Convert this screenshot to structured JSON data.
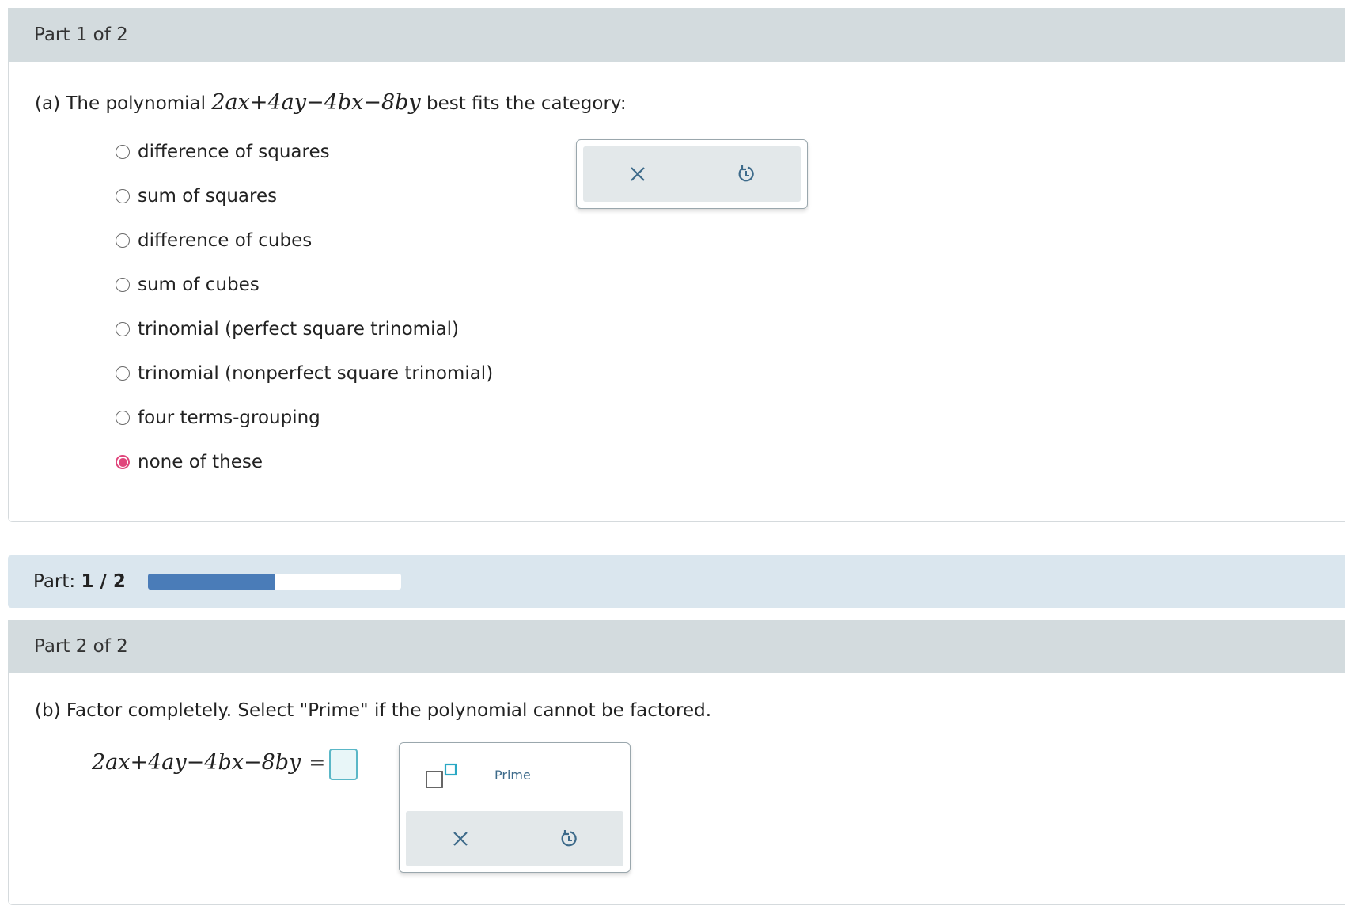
{
  "part1": {
    "header": "Part 1 of 2",
    "question_prefix": "(a) The polynomial ",
    "polynomial": "2ax+4ay−4bx−8by",
    "question_suffix": " best fits the category:",
    "options": [
      {
        "label": "difference of squares",
        "selected": false
      },
      {
        "label": "sum of squares",
        "selected": false
      },
      {
        "label": "difference of cubes",
        "selected": false
      },
      {
        "label": "sum of cubes",
        "selected": false
      },
      {
        "label": "trinomial (perfect square trinomial)",
        "selected": false
      },
      {
        "label": "trinomial (nonperfect square trinomial)",
        "selected": false
      },
      {
        "label": "four terms-grouping",
        "selected": false
      },
      {
        "label": "none of these",
        "selected": true
      }
    ]
  },
  "progress": {
    "label": "Part:",
    "current": "1",
    "separator": "/",
    "total": "2",
    "fraction": 0.5,
    "fill_color": "#4a7cb8"
  },
  "part2": {
    "header": "Part 2 of 2",
    "question": "(b) Factor completely. Select \"Prime\" if the polynomial cannot be factored.",
    "polynomial": "2ax+4ay−4bx−8by",
    "equals": "=",
    "prime_label": "Prime"
  },
  "colors": {
    "header_bg": "#d3dbde",
    "progress_bg": "#dae6ee",
    "selected_radio": "#e0457b",
    "icon": "#3d6a8a",
    "answer_border": "#5ab7c7"
  },
  "icons": {
    "clear": "close-icon",
    "reset": "undo-icon",
    "exponent": "exponent-template-icon"
  }
}
